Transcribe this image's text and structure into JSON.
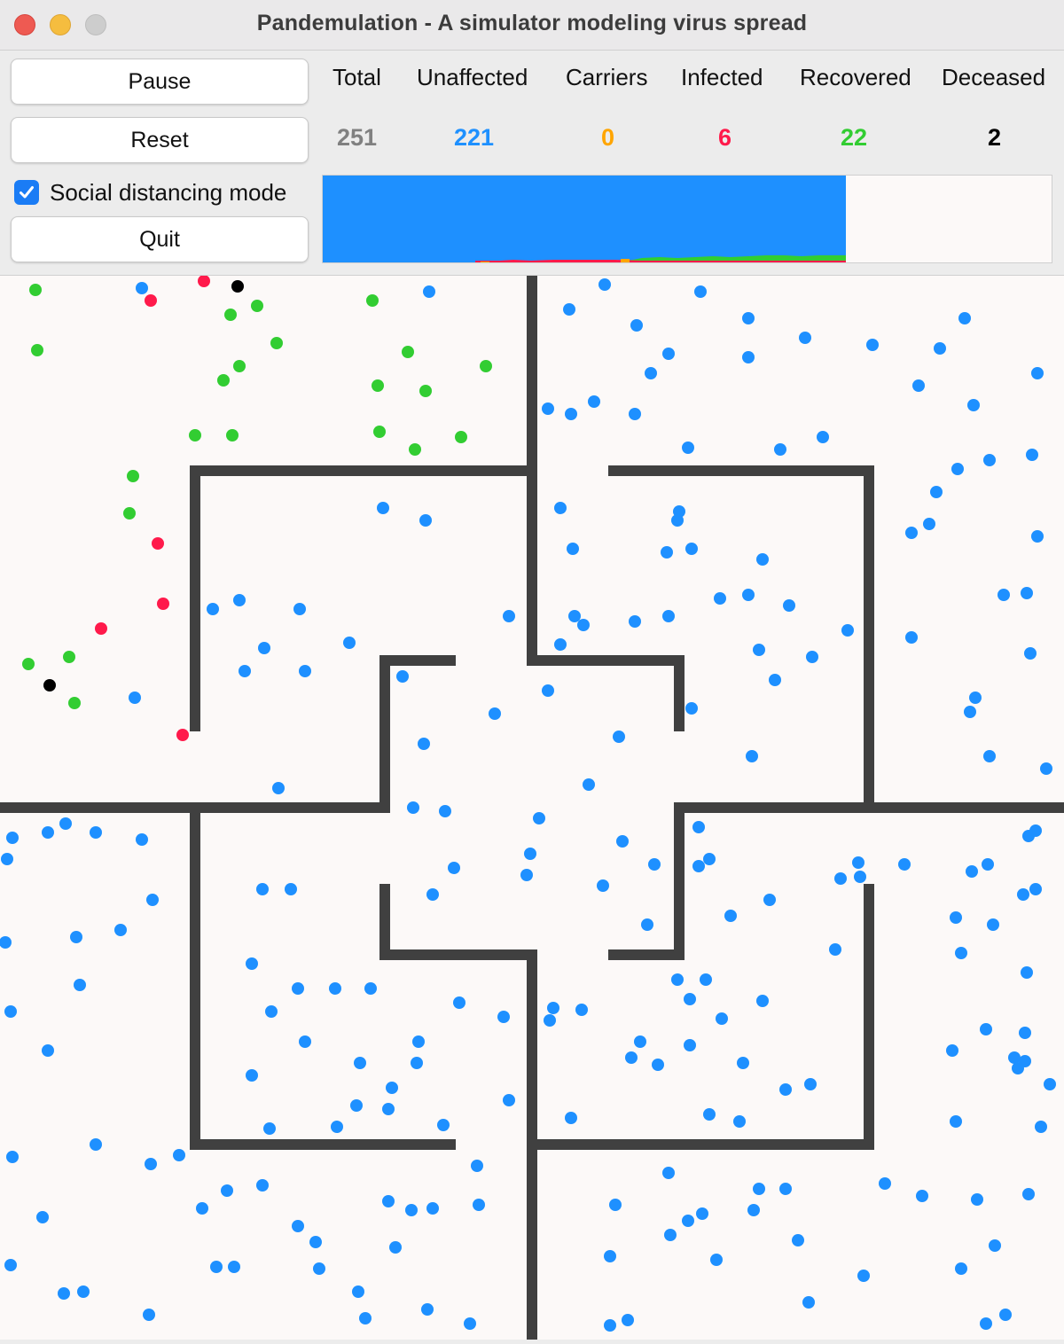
{
  "window": {
    "title": "Pandemulation - A simulator modeling virus spread"
  },
  "controls": {
    "pause_label": "Pause",
    "reset_label": "Reset",
    "social_distancing_label": "Social distancing mode",
    "social_distancing_checked": true,
    "quit_label": "Quit"
  },
  "stats": [
    {
      "label": "Total",
      "value": "251",
      "color": "#808080"
    },
    {
      "label": "Unaffected",
      "value": "221",
      "color": "#1e90ff"
    },
    {
      "label": "Carriers",
      "value": "0",
      "color": "#ffa500"
    },
    {
      "label": "Infected",
      "value": "6",
      "color": "#ff1a4b"
    },
    {
      "label": "Recovered",
      "value": "22",
      "color": "#32cd32"
    },
    {
      "label": "Deceased",
      "value": "2",
      "color": "#000000"
    }
  ],
  "colors": {
    "unaffected": "#1e90ff",
    "carrier": "#ffa500",
    "infected": "#ff1a4b",
    "recovered": "#32cd32",
    "deceased": "#000000",
    "wall": "#404040",
    "arena_bg": "#fcf9f8"
  },
  "icons": {
    "checkbox": "checkmark-icon"
  }
}
